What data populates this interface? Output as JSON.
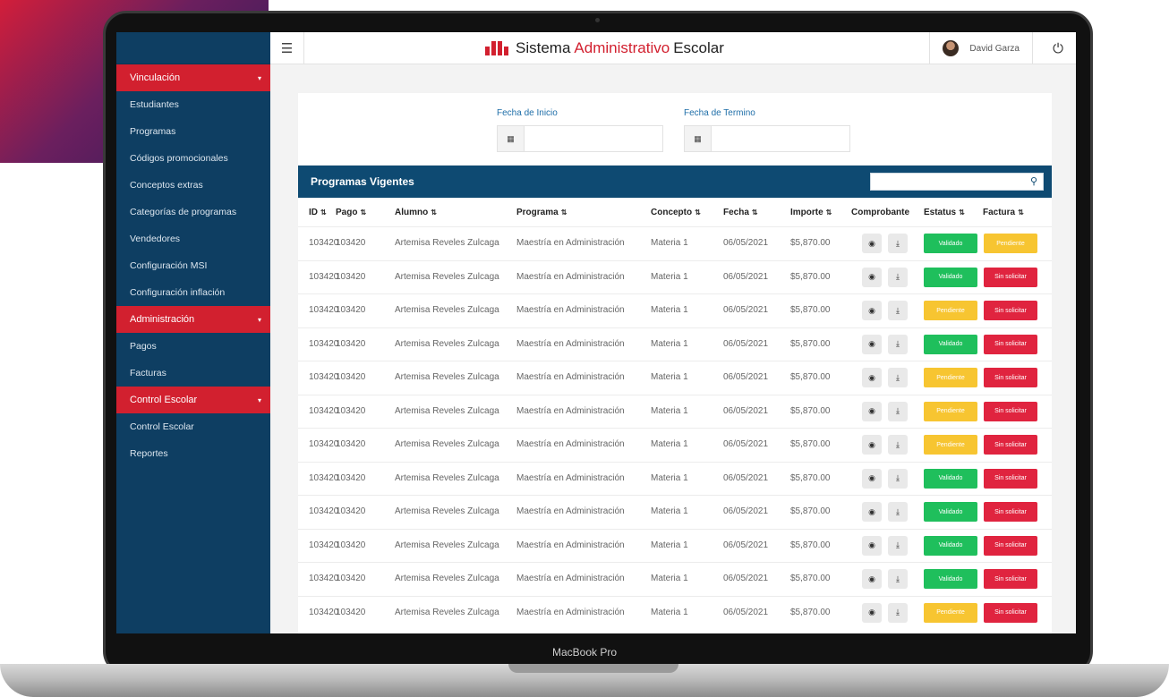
{
  "device": {
    "label": "MacBook Pro"
  },
  "app": {
    "title_part1": "Sistema",
    "title_part2": "Administrativo",
    "title_part3": "Escolar",
    "user_name": "David Garza"
  },
  "sidebar": {
    "sections": [
      {
        "label": "Vinculación",
        "items": [
          "Estudiantes",
          "Programas",
          "Códigos promocionales",
          "Conceptos extras",
          "Categorías de programas",
          "Vendedores",
          "Configuración MSI",
          "Configuración inflación"
        ]
      },
      {
        "label": "Administración",
        "items": [
          "Pagos",
          "Facturas"
        ]
      },
      {
        "label": "Control Escolar",
        "items": [
          "Control Escolar",
          "Reportes"
        ]
      }
    ]
  },
  "filters": {
    "start_label": "Fecha de Inicio",
    "end_label": "Fecha de Termino",
    "start_value": "",
    "end_value": ""
  },
  "table": {
    "title": "Programas Vigentes",
    "search_value": "",
    "columns": [
      "ID",
      "Pago",
      "Alumno",
      "Programa",
      "Concepto",
      "Fecha",
      "Importe",
      "Comprobante",
      "Estatus",
      "Factura"
    ],
    "rows": [
      {
        "id": "103420",
        "pago": "103420",
        "alumno": "Artemisa Reveles Zulcaga",
        "programa": "Maestría en Administración",
        "concepto": "Materia 1",
        "fecha": "06/05/2021",
        "importe": "$5,870.00",
        "estatus": "Validado",
        "factura": "Pendiente"
      },
      {
        "id": "103420",
        "pago": "103420",
        "alumno": "Artemisa Reveles Zulcaga",
        "programa": "Maestría en Administración",
        "concepto": "Materia 1",
        "fecha": "06/05/2021",
        "importe": "$5,870.00",
        "estatus": "Validado",
        "factura": "Sin solicitar"
      },
      {
        "id": "103420",
        "pago": "103420",
        "alumno": "Artemisa Reveles Zulcaga",
        "programa": "Maestría en Administración",
        "concepto": "Materia 1",
        "fecha": "06/05/2021",
        "importe": "$5,870.00",
        "estatus": "Pendiente",
        "factura": "Sin solicitar"
      },
      {
        "id": "103420",
        "pago": "103420",
        "alumno": "Artemisa Reveles Zulcaga",
        "programa": "Maestría en Administración",
        "concepto": "Materia 1",
        "fecha": "06/05/2021",
        "importe": "$5,870.00",
        "estatus": "Validado",
        "factura": "Sin solicitar"
      },
      {
        "id": "103420",
        "pago": "103420",
        "alumno": "Artemisa Reveles Zulcaga",
        "programa": "Maestría en Administración",
        "concepto": "Materia 1",
        "fecha": "06/05/2021",
        "importe": "$5,870.00",
        "estatus": "Pendiente",
        "factura": "Sin solicitar"
      },
      {
        "id": "103420",
        "pago": "103420",
        "alumno": "Artemisa Reveles Zulcaga",
        "programa": "Maestría en Administración",
        "concepto": "Materia 1",
        "fecha": "06/05/2021",
        "importe": "$5,870.00",
        "estatus": "Pendiente",
        "factura": "Sin solicitar"
      },
      {
        "id": "103420",
        "pago": "103420",
        "alumno": "Artemisa Reveles Zulcaga",
        "programa": "Maestría en Administración",
        "concepto": "Materia 1",
        "fecha": "06/05/2021",
        "importe": "$5,870.00",
        "estatus": "Pendiente",
        "factura": "Sin solicitar"
      },
      {
        "id": "103420",
        "pago": "103420",
        "alumno": "Artemisa Reveles Zulcaga",
        "programa": "Maestría en Administración",
        "concepto": "Materia 1",
        "fecha": "06/05/2021",
        "importe": "$5,870.00",
        "estatus": "Validado",
        "factura": "Sin solicitar"
      },
      {
        "id": "103420",
        "pago": "103420",
        "alumno": "Artemisa Reveles Zulcaga",
        "programa": "Maestría en Administración",
        "concepto": "Materia 1",
        "fecha": "06/05/2021",
        "importe": "$5,870.00",
        "estatus": "Validado",
        "factura": "Sin solicitar"
      },
      {
        "id": "103420",
        "pago": "103420",
        "alumno": "Artemisa Reveles Zulcaga",
        "programa": "Maestría en Administración",
        "concepto": "Materia 1",
        "fecha": "06/05/2021",
        "importe": "$5,870.00",
        "estatus": "Validado",
        "factura": "Sin solicitar"
      },
      {
        "id": "103420",
        "pago": "103420",
        "alumno": "Artemisa Reveles Zulcaga",
        "programa": "Maestría en Administración",
        "concepto": "Materia 1",
        "fecha": "06/05/2021",
        "importe": "$5,870.00",
        "estatus": "Validado",
        "factura": "Sin solicitar"
      },
      {
        "id": "103420",
        "pago": "103420",
        "alumno": "Artemisa Reveles Zulcaga",
        "programa": "Maestría en Administración",
        "concepto": "Materia 1",
        "fecha": "06/05/2021",
        "importe": "$5,870.00",
        "estatus": "Pendiente",
        "factura": "Sin solicitar"
      }
    ]
  },
  "colors": {
    "sidebar_bg": "#0e3e62",
    "brand_red": "#d2202f",
    "table_header": "#0e4a72",
    "validado": "#1fbf5c",
    "pendiente": "#f7c531",
    "sin_solicitar": "#e0243f",
    "label_blue": "#1e6ea8"
  },
  "icons": {
    "menu": "hamburger-icon",
    "power": "power-icon",
    "search": "search-icon",
    "calendar": "calendar-icon",
    "view": "eye-icon",
    "download": "download-icon",
    "sort": "sort-icon",
    "chevron": "chevron-down-icon"
  }
}
